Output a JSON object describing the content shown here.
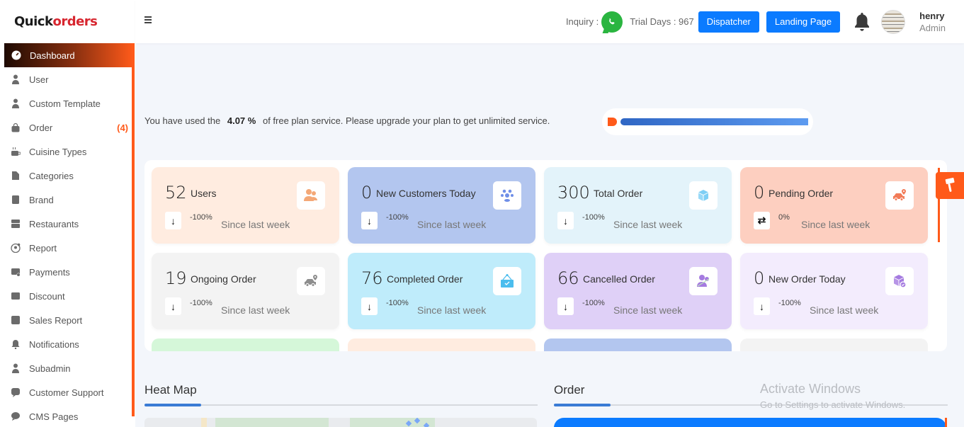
{
  "brand": {
    "logo_part1": "Quick",
    "logo_part2": "rders",
    "logo_accent_color": "#d7262f"
  },
  "sidebar": {
    "items": [
      {
        "label": "Dashboard",
        "icon": "dashboard-icon",
        "active": true
      },
      {
        "label": "User",
        "icon": "user-icon"
      },
      {
        "label": "Custom Template",
        "icon": "user-icon"
      },
      {
        "label": "Order",
        "icon": "shopping-bag-icon",
        "badge": "(4)"
      },
      {
        "label": "Cuisine Types",
        "icon": "mug-hot-icon"
      },
      {
        "label": "Categories",
        "icon": "file-icon"
      },
      {
        "label": "Brand",
        "icon": "tag-icon"
      },
      {
        "label": "Restaurants",
        "icon": "store-icon"
      },
      {
        "label": "Report",
        "icon": "report-icon"
      },
      {
        "label": "Payments",
        "icon": "card-check-icon"
      },
      {
        "label": "Discount",
        "icon": "percent-icon"
      },
      {
        "label": "Sales Report",
        "icon": "chart-icon"
      },
      {
        "label": "Notifications",
        "icon": "bell-icon"
      },
      {
        "label": "Subadmin",
        "icon": "user-icon"
      },
      {
        "label": "Customer Support",
        "icon": "question-bubble-icon"
      },
      {
        "label": "CMS Pages",
        "icon": "code-bubble-icon"
      }
    ]
  },
  "header": {
    "inquiry_label": "Inquiry :",
    "trial_label": "Trial Days : 967",
    "dispatcher_label": "Dispatcher",
    "landing_label": "Landing Page",
    "user_name": "henry",
    "user_role": "Admin"
  },
  "usage": {
    "prefix": "You have used the",
    "percent": "4.07 %",
    "suffix": "of free plan service. Please upgrade your plan to get unlimited service.",
    "progress_value": 0.0407
  },
  "stats": [
    {
      "value": "52",
      "label": "Users",
      "change": "-100%",
      "since": "Since last week",
      "trend": "↓",
      "bg": "#ffece0",
      "icon": "users-icon",
      "icon_color": "#f4a877"
    },
    {
      "value": "0",
      "label": "New Customers Today",
      "change": "-100%",
      "since": "Since last week",
      "trend": "↓",
      "bg": "#b3c6ef",
      "icon": "group-icon",
      "icon_color": "#6f8fe8"
    },
    {
      "value": "300",
      "label": "Total Order",
      "change": "-100%",
      "since": "Since last week",
      "trend": "↓",
      "bg": "#e3f3fa",
      "icon": "boxes-icon",
      "icon_color": "#7fcff5"
    },
    {
      "value": "0",
      "label": "Pending Order",
      "change": "0%",
      "since": "Since last week",
      "trend": "⇄",
      "bg": "#fdcfc0",
      "icon": "car-location-icon",
      "icon_color": "#f27b58"
    },
    {
      "value": "19",
      "label": "Ongoing Order",
      "change": "-100%",
      "since": "Since last week",
      "trend": "↓",
      "bg": "#f3f3f3",
      "icon": "car-location-icon",
      "icon_color": "#8e8e8e"
    },
    {
      "value": "76",
      "label": "Completed Order",
      "change": "-100%",
      "since": "Since last week",
      "trend": "↓",
      "bg": "#bfecfb",
      "icon": "sign-check-icon",
      "icon_color": "#4bbdee"
    },
    {
      "value": "66",
      "label": "Cancelled Order",
      "change": "-100%",
      "since": "Since last week",
      "trend": "↓",
      "bg": "#dfd0f7",
      "icon": "users-slash-icon",
      "icon_color": "#a57be0"
    },
    {
      "value": "0",
      "label": "New Order Today",
      "change": "-100%",
      "since": "Since last week",
      "trend": "↓",
      "bg": "#f3ecfd",
      "icon": "box-check-icon",
      "icon_color": "#a57be0"
    }
  ],
  "partial_card_colors": [
    "#d5f7d9",
    "#ffece0",
    "#b3c6ef",
    "#f3f3f3"
  ],
  "sections": {
    "heatmap_title": "Heat Map",
    "order_title": "Order"
  },
  "watermark": {
    "line1": "Activate Windows",
    "line2": "Go to Settings to activate Windows."
  },
  "colors": {
    "accent": "#ff5a1a",
    "primary": "#0b7bff",
    "progress": "#3a7bd5"
  }
}
